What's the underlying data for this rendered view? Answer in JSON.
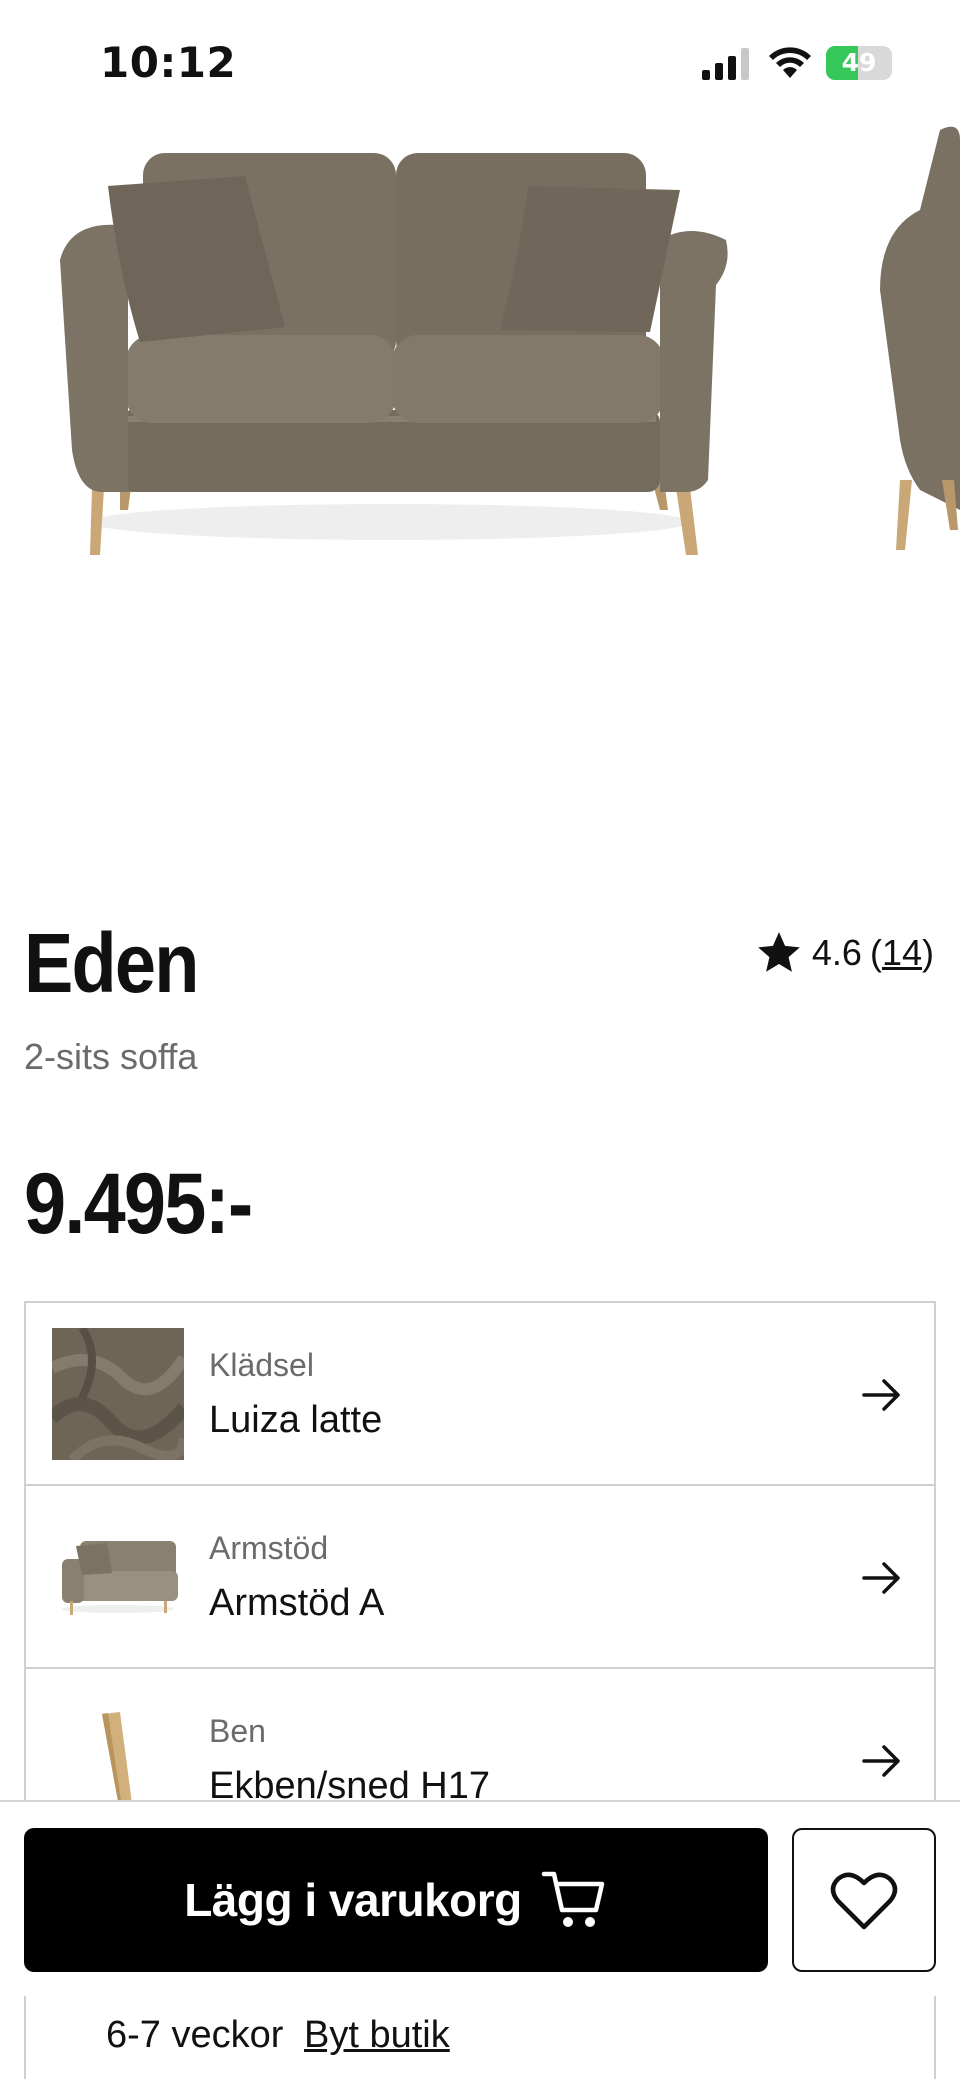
{
  "status_bar": {
    "time": "10:12",
    "battery_percent": "49",
    "battery_level": 0.49,
    "icons": [
      "signal-icon",
      "wifi-icon",
      "battery-icon"
    ]
  },
  "gallery": {
    "images": [
      "sofa-front-image",
      "sofa-angle-image"
    ]
  },
  "product": {
    "name": "Eden",
    "subtitle": "2-sits soffa",
    "rating": "4.6",
    "rating_open": "(",
    "review_count": "14",
    "rating_close": ")",
    "price": "9.495:-"
  },
  "options": [
    {
      "label": "Klädsel",
      "value": "Luiza latte",
      "thumb": "fabric-swatch"
    },
    {
      "label": "Armstöd",
      "value": "Armstöd A",
      "thumb": "sofa-thumbnail"
    },
    {
      "label": "Ben",
      "value": "Ekben/sned H17",
      "thumb": "leg-thumbnail"
    }
  ],
  "actions": {
    "add_to_cart_label": "Lägg i varukorg",
    "wishlist": "heart-icon"
  },
  "delivery": {
    "time": "6-7 veckor",
    "change_store_label": "Byt butik"
  },
  "colors": {
    "sofa": "#7a7062",
    "battery_green": "#35c759",
    "button_black": "#000000",
    "muted_text": "#6b6b6b",
    "border": "#cfcfcf"
  }
}
